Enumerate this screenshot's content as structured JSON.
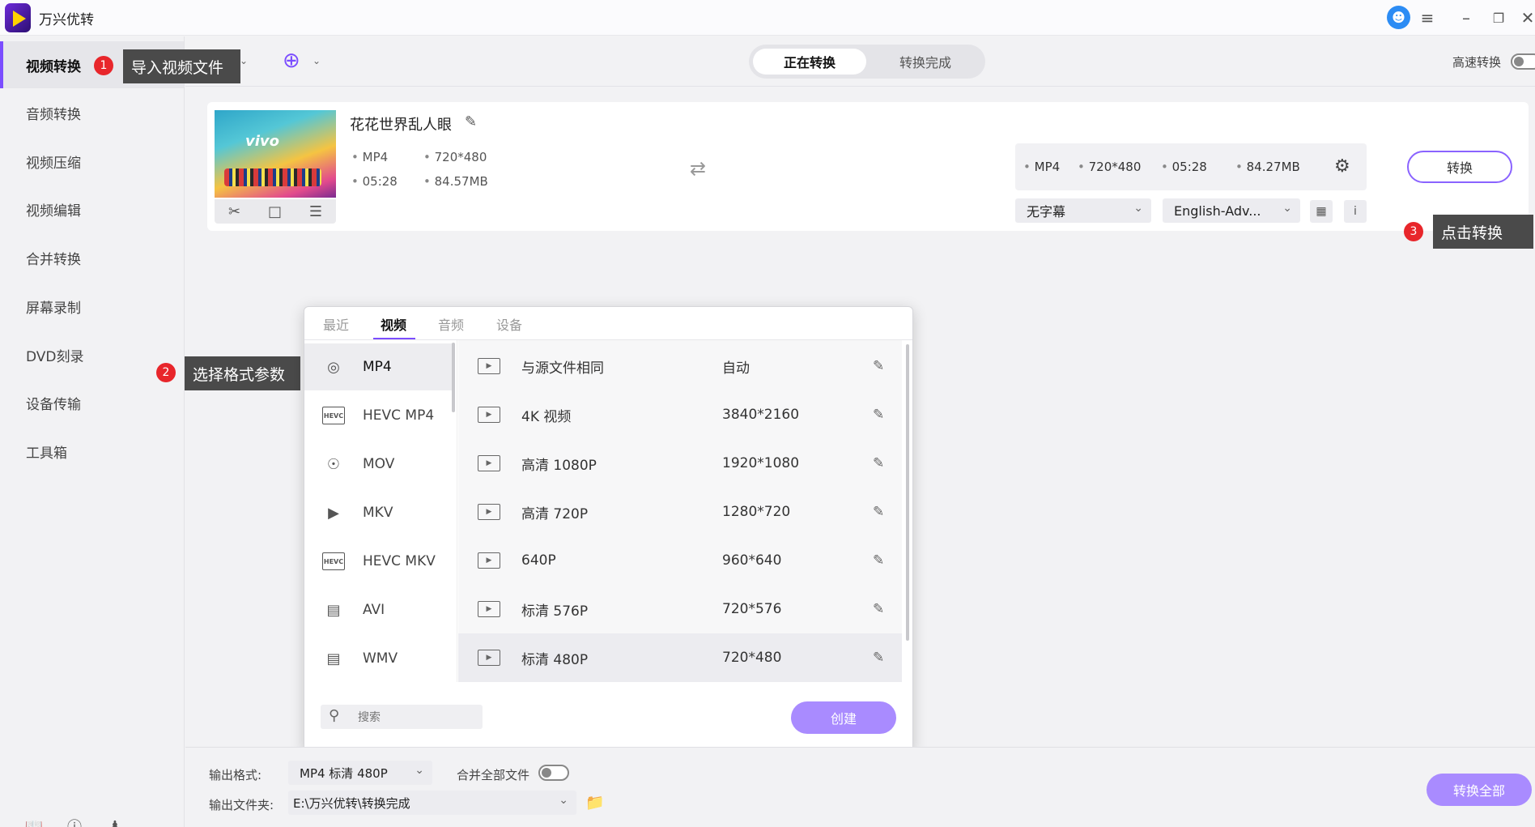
{
  "app": {
    "title": "万兴优转"
  },
  "sidebar": {
    "items": [
      {
        "label": "视频转换"
      },
      {
        "label": "音频转换"
      },
      {
        "label": "视频压缩"
      },
      {
        "label": "视频编辑"
      },
      {
        "label": "合并转换"
      },
      {
        "label": "屏幕录制"
      },
      {
        "label": "DVD刻录"
      },
      {
        "label": "设备传输"
      },
      {
        "label": "工具箱"
      }
    ]
  },
  "header": {
    "tabs": [
      {
        "label": "正在转换"
      },
      {
        "label": "转换完成"
      }
    ],
    "high_speed_label": "高速转换"
  },
  "file": {
    "name": "花花世界乱人眼",
    "format": "MP4",
    "resolution": "720*480",
    "duration": "05:28",
    "size": "84.57MB",
    "thumb_brand": "vivo"
  },
  "target": {
    "format": "MP4",
    "resolution": "720*480",
    "duration": "05:28",
    "size": "84.27MB",
    "subtitle": "无字幕",
    "audio": "English-Adv...",
    "info_label": "i",
    "convert_label": "转换"
  },
  "callouts": [
    {
      "num": "1",
      "text": "导入视频文件"
    },
    {
      "num": "2",
      "text": "选择格式参数"
    },
    {
      "num": "3",
      "text": "点击转换"
    }
  ],
  "format_popup": {
    "tabs": [
      {
        "label": "最近"
      },
      {
        "label": "视频"
      },
      {
        "label": "音频"
      },
      {
        "label": "设备"
      }
    ],
    "active_tab": "视频",
    "formats": [
      {
        "label": "MP4",
        "icon": "disc-icon"
      },
      {
        "label": "HEVC MP4",
        "icon": "hevc-icon",
        "badge": "HEVC"
      },
      {
        "label": "MOV",
        "icon": "quicktime-icon"
      },
      {
        "label": "MKV",
        "icon": "video-icon"
      },
      {
        "label": "HEVC MKV",
        "icon": "hevc-icon",
        "badge": "HEVC"
      },
      {
        "label": "AVI",
        "icon": "clapper-icon"
      },
      {
        "label": "WMV",
        "icon": "clapper-icon"
      }
    ],
    "selected_format": "MP4",
    "presets": [
      {
        "name": "与源文件相同",
        "res": "自动"
      },
      {
        "name": "4K 视频",
        "res": "3840*2160"
      },
      {
        "name": "高清 1080P",
        "res": "1920*1080"
      },
      {
        "name": "高清 720P",
        "res": "1280*720"
      },
      {
        "name": "640P",
        "res": "960*640"
      },
      {
        "name": "标清 576P",
        "res": "720*576"
      },
      {
        "name": "标清 480P",
        "res": "720*480"
      }
    ],
    "selected_preset": "标清 480P",
    "search_placeholder": "搜索",
    "create_label": "创建"
  },
  "bottom": {
    "output_format_label": "输出格式:",
    "output_format_value": "MP4 标清 480P",
    "merge_label": "合并全部文件",
    "output_folder_label": "输出文件夹:",
    "output_folder_value": "E:\\万兴优转\\转换完成",
    "convert_all_label": "转换全部"
  },
  "colors": {
    "accent": "#7b4dff",
    "button_fill": "#a98bff",
    "badge": "#e8262b",
    "callout_bg": "#4a4a4a"
  }
}
